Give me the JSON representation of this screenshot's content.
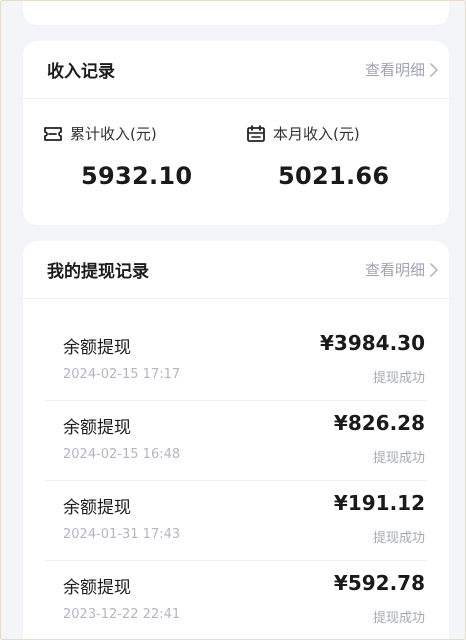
{
  "income": {
    "title": "收入记录",
    "detail_link": "查看明细",
    "total_label": "累计收入(元)",
    "total_value": "5932.10",
    "month_label": "本月收入(元)",
    "month_value": "5021.66"
  },
  "withdrawals": {
    "title": "我的提现记录",
    "detail_link": "查看明细",
    "records": [
      {
        "title": "余额提现",
        "time": "2024-02-15 17:17",
        "amount": "¥3984.30",
        "status": "提现成功"
      },
      {
        "title": "余额提现",
        "time": "2024-02-15 16:48",
        "amount": "¥826.28",
        "status": "提现成功"
      },
      {
        "title": "余额提现",
        "time": "2024-01-31 17:43",
        "amount": "¥191.12",
        "status": "提现成功"
      },
      {
        "title": "余额提现",
        "time": "2023-12-22 22:41",
        "amount": "¥592.78",
        "status": "提现成功"
      }
    ]
  },
  "colors": {
    "page_bg": "#f4f5f9",
    "card_bg": "#ffffff",
    "muted_text": "#9fa3b3",
    "divider": "#eeeff3"
  },
  "icons": {
    "total": "ticket-icon",
    "month": "calendar-icon",
    "link": "chevron-right-icon"
  }
}
